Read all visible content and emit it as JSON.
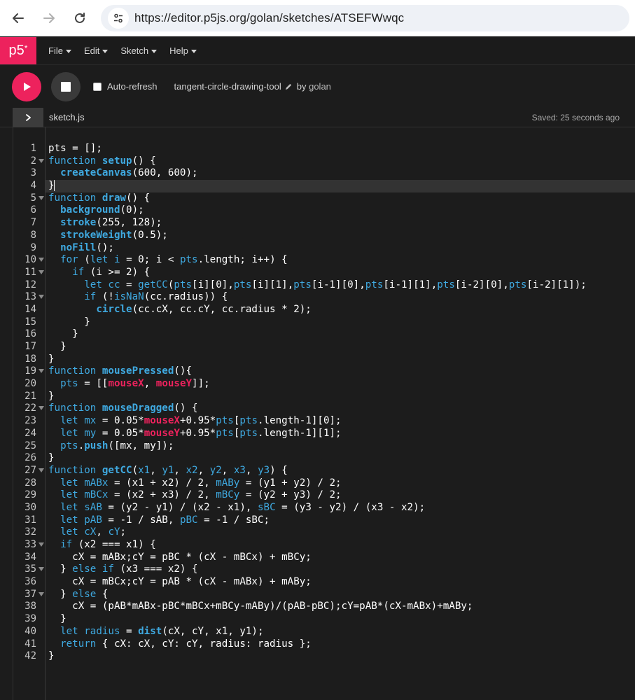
{
  "browser": {
    "url": "https://editor.p5js.org/golan/sketches/ATSEFWwqc"
  },
  "app": {
    "logo": "p5",
    "logo_sup": "*",
    "menu": [
      "File",
      "Edit",
      "Sketch",
      "Help"
    ]
  },
  "toolbar": {
    "auto_refresh_label": "Auto-refresh",
    "auto_refresh_checked": false,
    "sketch_name": "tangent-circle-drawing-tool",
    "by_label": "by",
    "author": "golan"
  },
  "file": {
    "name": "sketch.js",
    "saved_status": "Saved: 25 seconds ago"
  },
  "editor": {
    "active_line": 4,
    "fold_lines": [
      2,
      5,
      10,
      11,
      13,
      19,
      22,
      27,
      33,
      35,
      37
    ],
    "lines": [
      [
        [
          "nm",
          "pts = [];"
        ]
      ],
      [
        [
          "kw",
          "function "
        ],
        [
          "fn",
          "setup"
        ],
        [
          "nm",
          "() {"
        ]
      ],
      [
        [
          "nm",
          "  "
        ],
        [
          "fn",
          "createCanvas"
        ],
        [
          "nm",
          "(600, 600);"
        ]
      ],
      [
        [
          "nm",
          "}"
        ]
      ],
      [
        [
          "kw",
          "function "
        ],
        [
          "fn",
          "draw"
        ],
        [
          "nm",
          "() {"
        ]
      ],
      [
        [
          "nm",
          "  "
        ],
        [
          "fn",
          "background"
        ],
        [
          "nm",
          "(0);"
        ]
      ],
      [
        [
          "nm",
          "  "
        ],
        [
          "fn",
          "stroke"
        ],
        [
          "nm",
          "(255, 128);"
        ]
      ],
      [
        [
          "nm",
          "  "
        ],
        [
          "fn",
          "strokeWeight"
        ],
        [
          "nm",
          "(0.5);"
        ]
      ],
      [
        [
          "nm",
          "  "
        ],
        [
          "fn",
          "noFill"
        ],
        [
          "nm",
          "();"
        ]
      ],
      [
        [
          "nm",
          "  "
        ],
        [
          "kw",
          "for"
        ],
        [
          "nm",
          " ("
        ],
        [
          "kw",
          "let "
        ],
        [
          "var",
          "i"
        ],
        [
          "nm",
          " = 0; i < "
        ],
        [
          "var",
          "pts"
        ],
        [
          "nm",
          ".length; i++) {"
        ]
      ],
      [
        [
          "nm",
          "    "
        ],
        [
          "kw",
          "if"
        ],
        [
          "nm",
          " (i >= 2) {"
        ]
      ],
      [
        [
          "nm",
          "      "
        ],
        [
          "kw",
          "let "
        ],
        [
          "var",
          "cc"
        ],
        [
          "nm",
          " = "
        ],
        [
          "var",
          "getCC"
        ],
        [
          "nm",
          "("
        ],
        [
          "var",
          "pts"
        ],
        [
          "nm",
          "[i][0],"
        ],
        [
          "var",
          "pts"
        ],
        [
          "nm",
          "[i][1],"
        ],
        [
          "var",
          "pts"
        ],
        [
          "nm",
          "[i-1][0],"
        ],
        [
          "var",
          "pts"
        ],
        [
          "nm",
          "[i-1][1],"
        ],
        [
          "var",
          "pts"
        ],
        [
          "nm",
          "[i-2][0],"
        ],
        [
          "var",
          "pts"
        ],
        [
          "nm",
          "[i-2][1]);"
        ]
      ],
      [
        [
          "nm",
          "      "
        ],
        [
          "kw",
          "if"
        ],
        [
          "nm",
          " (!"
        ],
        [
          "var",
          "isNaN"
        ],
        [
          "nm",
          "(cc.radius)) {"
        ]
      ],
      [
        [
          "nm",
          "        "
        ],
        [
          "fn",
          "circle"
        ],
        [
          "nm",
          "(cc.cX, cc.cY, cc.radius * 2);"
        ]
      ],
      [
        [
          "nm",
          "      }"
        ]
      ],
      [
        [
          "nm",
          "    }"
        ]
      ],
      [
        [
          "nm",
          "  }"
        ]
      ],
      [
        [
          "nm",
          "}"
        ]
      ],
      [
        [
          "kw",
          "function "
        ],
        [
          "fn",
          "mousePressed"
        ],
        [
          "nm",
          "(){"
        ]
      ],
      [
        [
          "nm",
          "  "
        ],
        [
          "var",
          "pts"
        ],
        [
          "nm",
          " = [["
        ],
        [
          "pink",
          "mouseX"
        ],
        [
          "nm",
          ", "
        ],
        [
          "pink",
          "mouseY"
        ],
        [
          "nm",
          "]];"
        ]
      ],
      [
        [
          "nm",
          "}"
        ]
      ],
      [
        [
          "kw",
          "function "
        ],
        [
          "fn",
          "mouseDragged"
        ],
        [
          "nm",
          "() {"
        ]
      ],
      [
        [
          "nm",
          "  "
        ],
        [
          "kw",
          "let "
        ],
        [
          "var",
          "mx"
        ],
        [
          "nm",
          " = 0.05*"
        ],
        [
          "pink",
          "mouseX"
        ],
        [
          "nm",
          "+0.95*"
        ],
        [
          "var",
          "pts"
        ],
        [
          "nm",
          "["
        ],
        [
          "var",
          "pts"
        ],
        [
          "nm",
          ".length-1][0];"
        ]
      ],
      [
        [
          "nm",
          "  "
        ],
        [
          "kw",
          "let "
        ],
        [
          "var",
          "my"
        ],
        [
          "nm",
          " = 0.05*"
        ],
        [
          "pink",
          "mouseY"
        ],
        [
          "nm",
          "+0.95*"
        ],
        [
          "var",
          "pts"
        ],
        [
          "nm",
          "["
        ],
        [
          "var",
          "pts"
        ],
        [
          "nm",
          ".length-1][1];"
        ]
      ],
      [
        [
          "nm",
          "  "
        ],
        [
          "var",
          "pts"
        ],
        [
          "nm",
          "."
        ],
        [
          "fn",
          "push"
        ],
        [
          "nm",
          "([mx, my]);"
        ]
      ],
      [
        [
          "nm",
          "}"
        ]
      ],
      [
        [
          "kw",
          "function "
        ],
        [
          "fn",
          "getCC"
        ],
        [
          "nm",
          "("
        ],
        [
          "var",
          "x1"
        ],
        [
          "nm",
          ", "
        ],
        [
          "var",
          "y1"
        ],
        [
          "nm",
          ", "
        ],
        [
          "var",
          "x2"
        ],
        [
          "nm",
          ", "
        ],
        [
          "var",
          "y2"
        ],
        [
          "nm",
          ", "
        ],
        [
          "var",
          "x3"
        ],
        [
          "nm",
          ", "
        ],
        [
          "var",
          "y3"
        ],
        [
          "nm",
          ") {"
        ]
      ],
      [
        [
          "nm",
          "  "
        ],
        [
          "kw",
          "let "
        ],
        [
          "var",
          "mABx"
        ],
        [
          "nm",
          " = (x1 + x2) / 2, "
        ],
        [
          "var",
          "mABy"
        ],
        [
          "nm",
          " = (y1 + y2) / 2;"
        ]
      ],
      [
        [
          "nm",
          "  "
        ],
        [
          "kw",
          "let "
        ],
        [
          "var",
          "mBCx"
        ],
        [
          "nm",
          " = (x2 + x3) / 2, "
        ],
        [
          "var",
          "mBCy"
        ],
        [
          "nm",
          " = (y2 + y3) / 2;"
        ]
      ],
      [
        [
          "nm",
          "  "
        ],
        [
          "kw",
          "let "
        ],
        [
          "var",
          "sAB"
        ],
        [
          "nm",
          " = (y2 - y1) / (x2 - x1), "
        ],
        [
          "var",
          "sBC"
        ],
        [
          "nm",
          " = (y3 - y2) / (x3 - x2);"
        ]
      ],
      [
        [
          "nm",
          "  "
        ],
        [
          "kw",
          "let "
        ],
        [
          "var",
          "pAB"
        ],
        [
          "nm",
          " = -1 / sAB, "
        ],
        [
          "var",
          "pBC"
        ],
        [
          "nm",
          " = -1 / sBC;"
        ]
      ],
      [
        [
          "nm",
          "  "
        ],
        [
          "kw",
          "let "
        ],
        [
          "var",
          "cX"
        ],
        [
          "nm",
          ", "
        ],
        [
          "var",
          "cY"
        ],
        [
          "nm",
          ";"
        ]
      ],
      [
        [
          "nm",
          "  "
        ],
        [
          "kw",
          "if"
        ],
        [
          "nm",
          " (x2 === x1) {"
        ]
      ],
      [
        [
          "nm",
          "    cX = mABx;cY = pBC * (cX - mBCx) + mBCy;"
        ]
      ],
      [
        [
          "nm",
          "  } "
        ],
        [
          "kw",
          "else if"
        ],
        [
          "nm",
          " (x3 === x2) {"
        ]
      ],
      [
        [
          "nm",
          "    cX = mBCx;cY = pAB * (cX - mABx) + mABy;"
        ]
      ],
      [
        [
          "nm",
          "  } "
        ],
        [
          "kw",
          "else"
        ],
        [
          "nm",
          " {"
        ]
      ],
      [
        [
          "nm",
          "    cX = (pAB*mABx-pBC*mBCx+mBCy-mABy)/(pAB-pBC);cY=pAB*(cX-mABx)+mABy;"
        ]
      ],
      [
        [
          "nm",
          "  }"
        ]
      ],
      [
        [
          "nm",
          "  "
        ],
        [
          "kw",
          "let "
        ],
        [
          "var",
          "radius"
        ],
        [
          "nm",
          " = "
        ],
        [
          "fn",
          "dist"
        ],
        [
          "nm",
          "(cX, cY, x1, y1);"
        ]
      ],
      [
        [
          "nm",
          "  "
        ],
        [
          "kw",
          "return"
        ],
        [
          "nm",
          " { cX: cX, cY: cY, radius: radius };"
        ]
      ],
      [
        [
          "nm",
          "}"
        ]
      ]
    ]
  }
}
